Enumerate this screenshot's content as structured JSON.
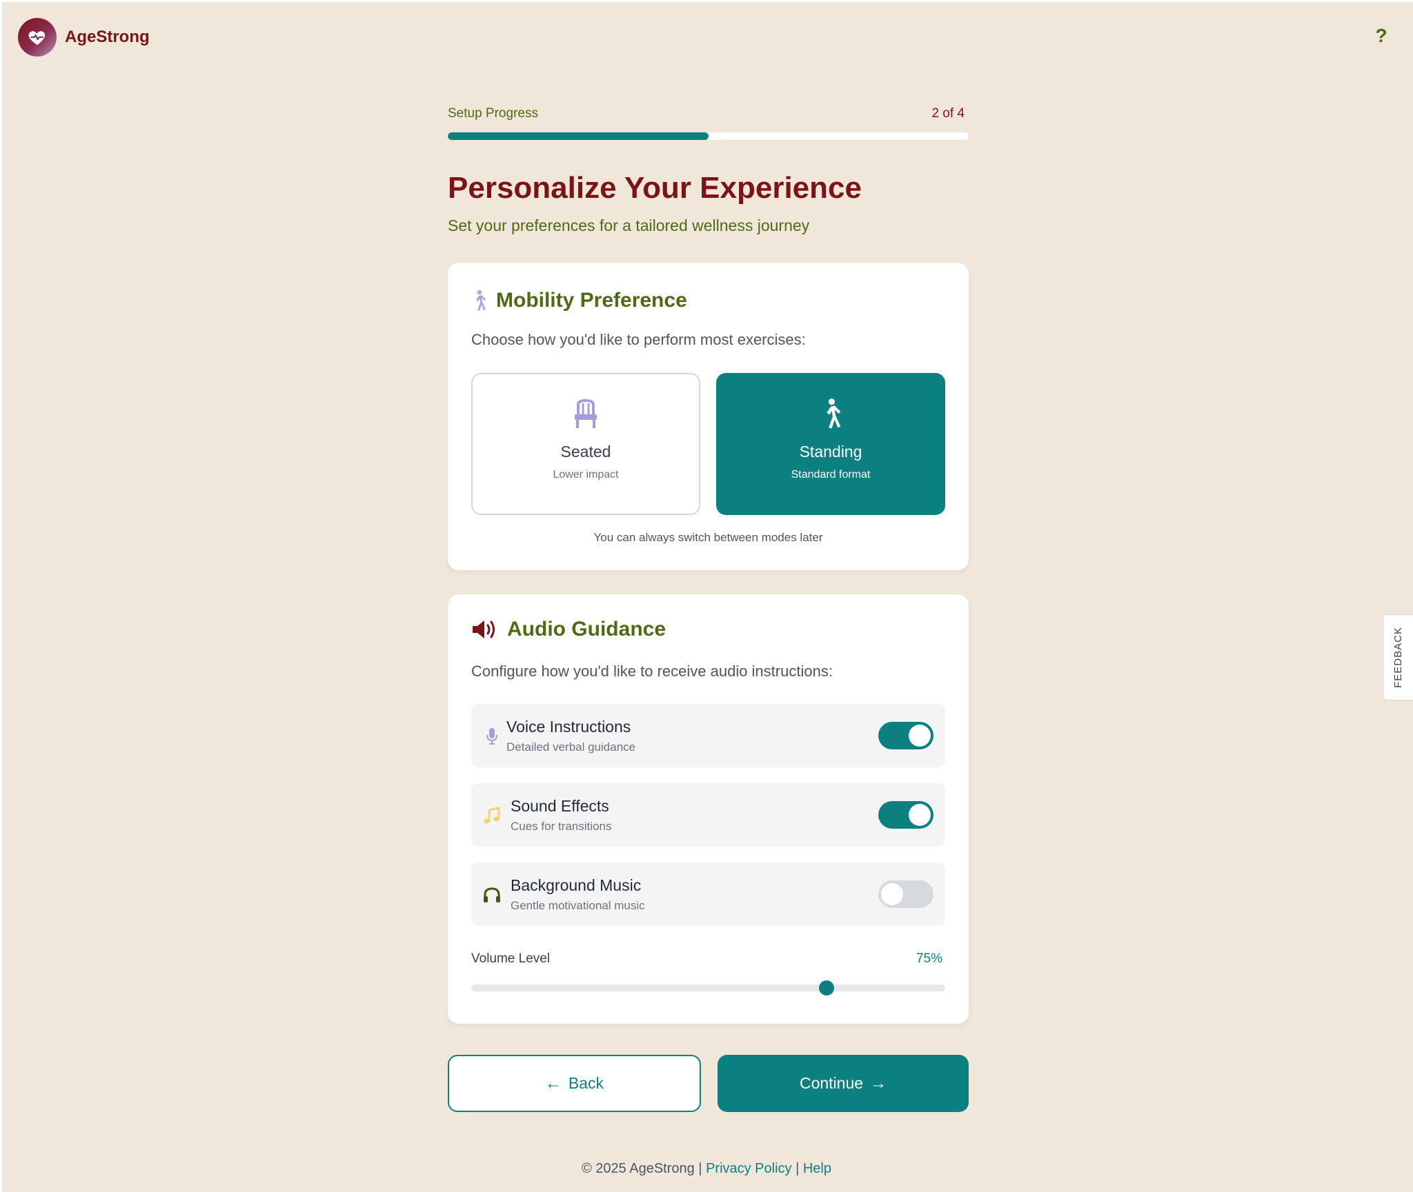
{
  "header": {
    "app_name": "AgeStrong",
    "help_label": "?"
  },
  "progress": {
    "label": "Setup Progress",
    "count": "2 of 4",
    "fraction": 0.5
  },
  "page": {
    "title": "Personalize Your Experience",
    "subtitle": "Set your preferences for a tailored wellness journey"
  },
  "mobility": {
    "title": "Mobility Preference",
    "description": "Choose how you'd like to perform most exercises:",
    "options": [
      {
        "label": "Seated",
        "sub": "Lower impact",
        "selected": false
      },
      {
        "label": "Standing",
        "sub": "Standard format",
        "selected": true
      }
    ],
    "note": "You can always switch between modes later"
  },
  "audio": {
    "title": "Audio Guidance",
    "description": "Configure how you'd like to receive audio instructions:",
    "rows": [
      {
        "label": "Voice Instructions",
        "sub": "Detailed verbal guidance",
        "on": true,
        "icon": "microphone-icon"
      },
      {
        "label": "Sound Effects",
        "sub": "Cues for transitions",
        "on": true,
        "icon": "music-note-icon"
      },
      {
        "label": "Background Music",
        "sub": "Gentle motivational music",
        "on": false,
        "icon": "headphones-icon"
      }
    ],
    "volume_label": "Volume Level",
    "volume_value": "75%",
    "volume_fraction": 0.75
  },
  "buttons": {
    "back": "Back",
    "back_glyph": "←",
    "continue": "Continue",
    "continue_glyph": "→"
  },
  "footer": {
    "copyright": "© 2025 AgeStrong",
    "sep1": " | ",
    "privacy": "Privacy Policy",
    "sep2": " | ",
    "help": "Help"
  },
  "feedback": {
    "label": "FEEDBACK"
  },
  "colors": {
    "background": "#f0e6da",
    "accent": "#0b8080",
    "brand": "#7a1416",
    "olive": "#4f6a14"
  }
}
